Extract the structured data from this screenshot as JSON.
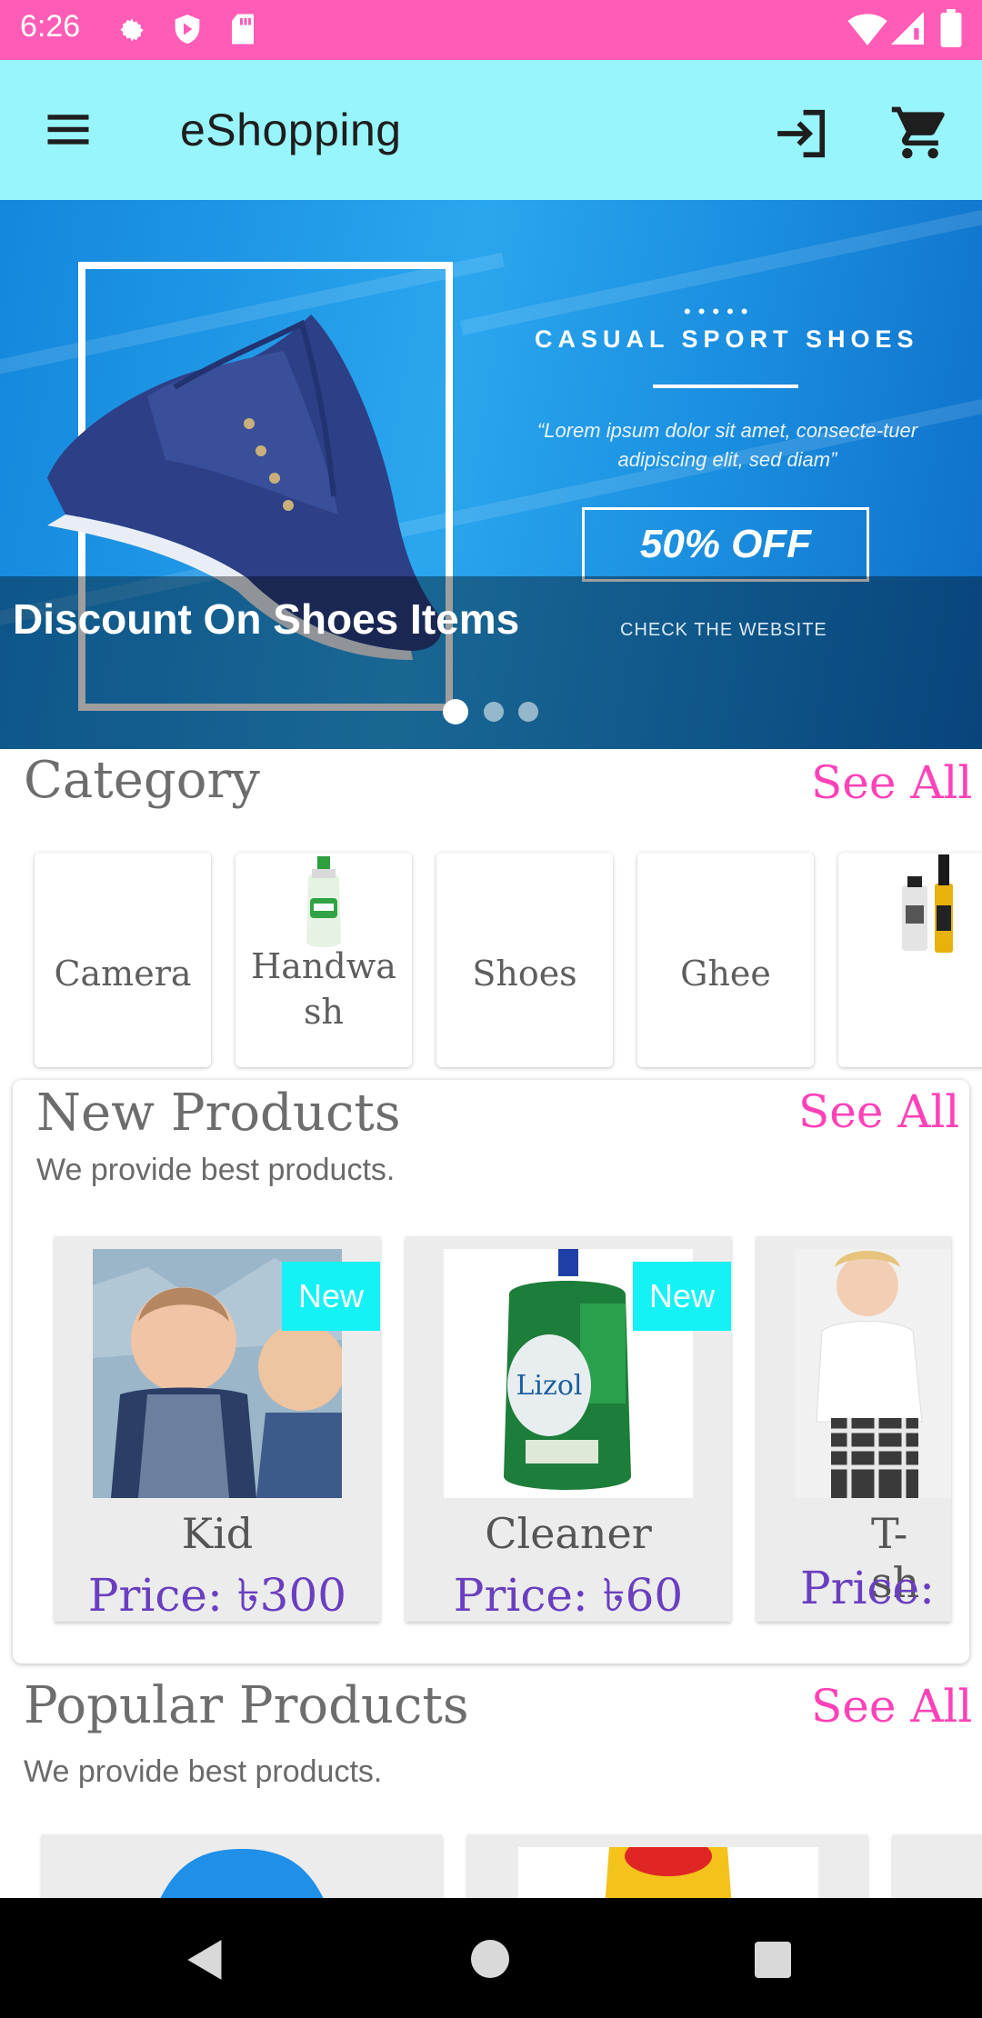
{
  "status_bar": {
    "time": "6:26"
  },
  "app_bar": {
    "title": "eShopping"
  },
  "banner": {
    "caption": "Discount On Shoes Items",
    "promo_heading": "CASUAL SPORT SHOES",
    "promo_quote": "“Lorem ipsum dolor sit amet, consecte-tuer adipiscing elit, sed diam”",
    "promo_discount": "50% OFF",
    "promo_link": "CHECK THE WEBSITE",
    "slide_count": 3,
    "active_slide": 1
  },
  "category": {
    "title": "Category",
    "see_all": "See All",
    "items": [
      {
        "label": "Camera"
      },
      {
        "label": "Handwash"
      },
      {
        "label": "Shoes"
      },
      {
        "label": "Ghee"
      },
      {
        "label": ""
      }
    ]
  },
  "new_products": {
    "title": "New Products",
    "subtitle": "We provide best products.",
    "see_all": "See All",
    "items": [
      {
        "name": "Kid",
        "price": "Price: ৳300",
        "badge": "New"
      },
      {
        "name": "Cleaner",
        "price": "Price: ৳60",
        "badge": "New"
      },
      {
        "name": "T-sh",
        "price": "Price: ",
        "badge": ""
      }
    ]
  },
  "popular_products": {
    "title": "Popular Products",
    "subtitle": "We provide best products.",
    "see_all": "See All"
  },
  "colors": {
    "status_bar": "#ff5cb7",
    "app_bar": "#98f5fb",
    "accent_pink": "#ff42b8",
    "price_purple": "#6a3fbf",
    "badge_cyan": "#14f2f6"
  }
}
